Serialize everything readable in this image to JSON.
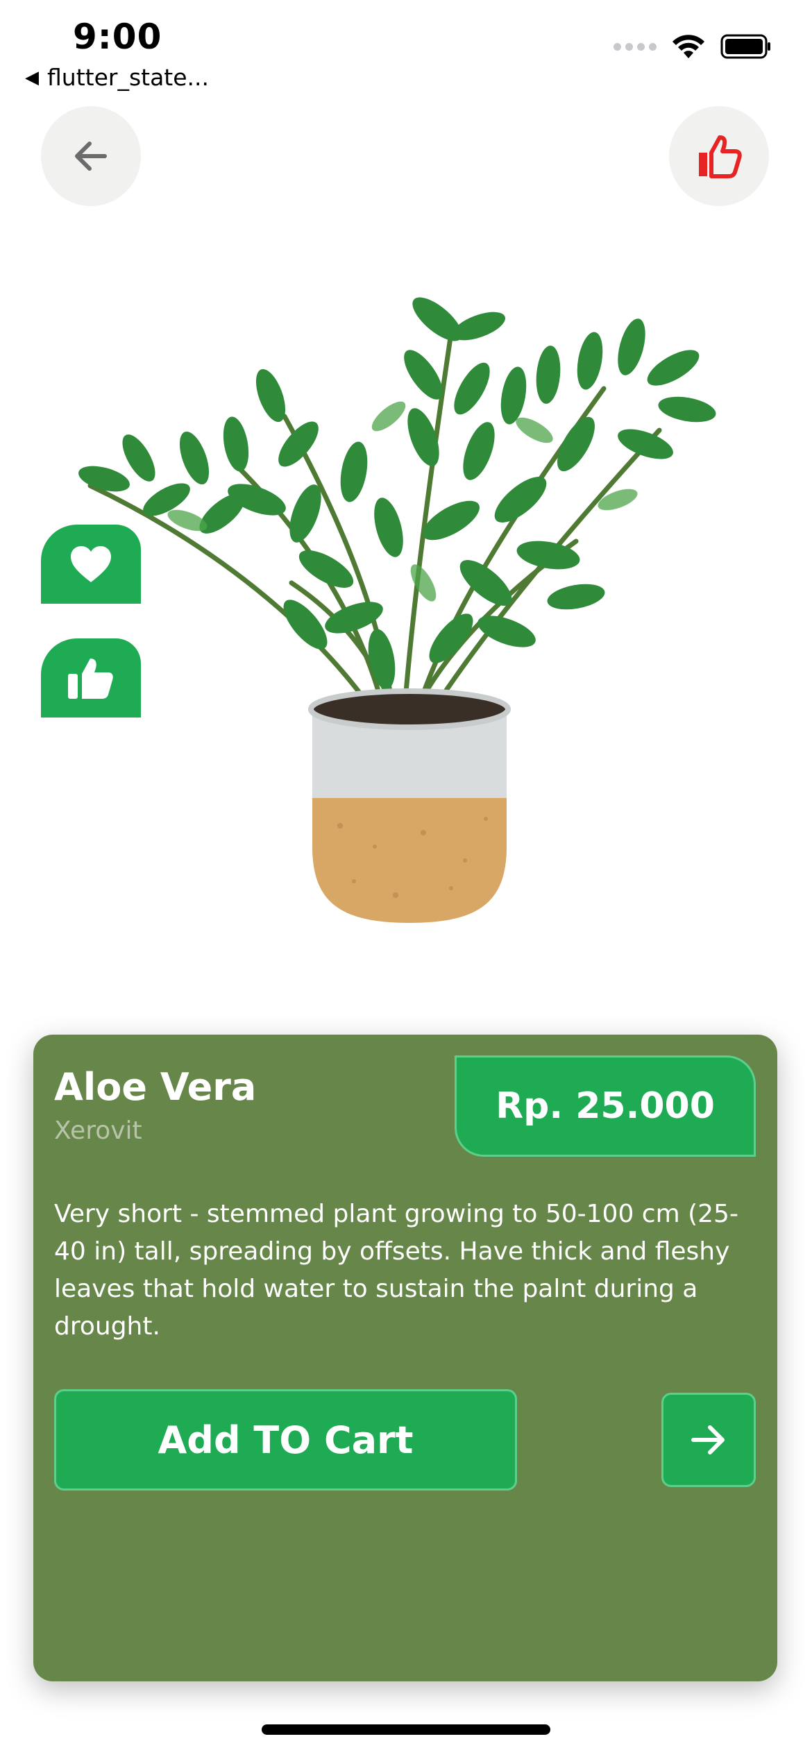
{
  "status_bar": {
    "time": "9:00",
    "back_app": "flutter_state..."
  },
  "icons": {
    "back": "arrow-left-icon",
    "like_top": "thumbs-up-icon",
    "favorite": "heart-icon",
    "thumb_side": "thumbs-up-icon",
    "next": "arrow-right-icon",
    "wifi": "wifi-icon",
    "battery": "battery-icon"
  },
  "product": {
    "name": "Aloe Vera",
    "brand": "Xerovit",
    "price": "Rp. 25.000",
    "description": "Very short - stemmed plant growing to 50-100 cm (25-40 in) tall, spreading by offsets. Have thick and fleshy leaves that hold water to sustain the palnt during a drought."
  },
  "actions": {
    "add_to_cart": "Add TO Cart"
  },
  "colors": {
    "accent_green": "#1faa54",
    "card_olive": "#67874a",
    "like_red": "#e82323"
  }
}
